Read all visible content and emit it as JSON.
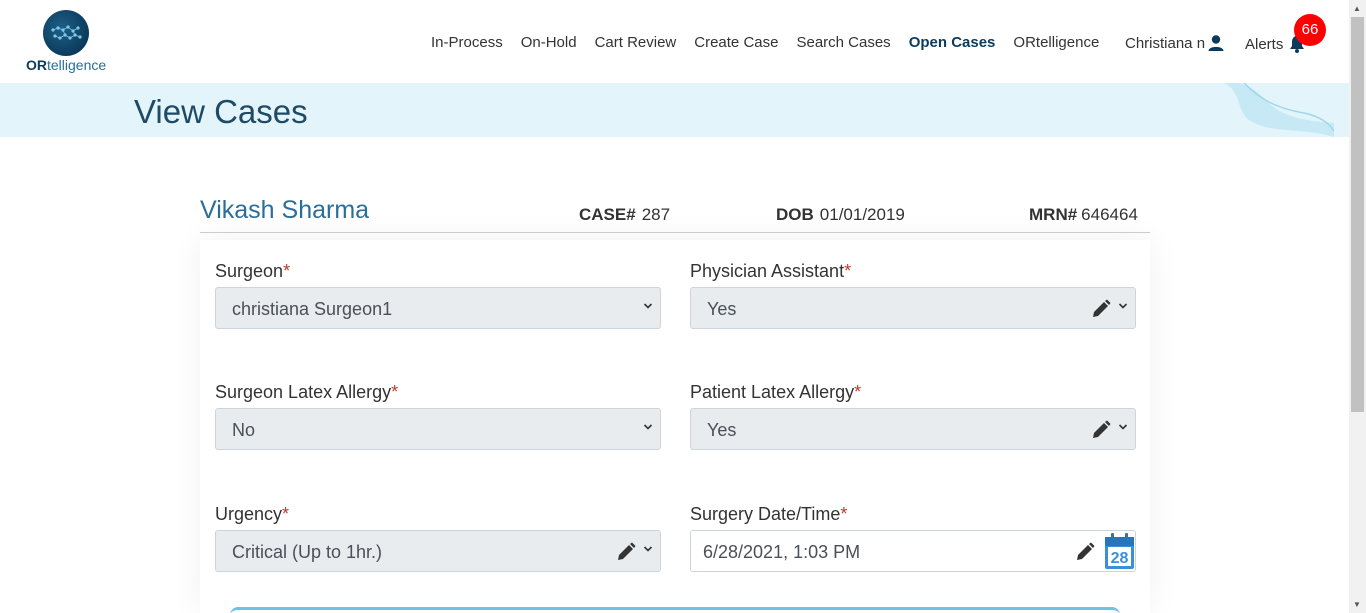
{
  "logo": {
    "wordmark_bold": "OR",
    "wordmark_rest": "telligence"
  },
  "nav": {
    "links": [
      {
        "label": "In-Process",
        "active": false
      },
      {
        "label": "On-Hold",
        "active": false
      },
      {
        "label": "Cart Review",
        "active": false
      },
      {
        "label": "Create Case",
        "active": false
      },
      {
        "label": "Search Cases",
        "active": false
      },
      {
        "label": "Open Cases",
        "active": true
      },
      {
        "label": "ORtelligence",
        "active": false
      }
    ],
    "user_label": "Christiana n",
    "alerts_label": "Alerts",
    "alerts_count": "66"
  },
  "page": {
    "title": "View Cases"
  },
  "patient": {
    "name": "Vikash Sharma",
    "case_label": "CASE#",
    "case_value": "287",
    "dob_label": "DOB",
    "dob_value": "01/01/2019",
    "mrn_label": "MRN#",
    "mrn_value": "646464"
  },
  "form": {
    "required_mark": "*",
    "surgeon": {
      "label": "Surgeon",
      "value": "christiana Surgeon1"
    },
    "physician_assistant": {
      "label": "Physician Assistant",
      "value": "Yes"
    },
    "surgeon_latex_allergy": {
      "label": "Surgeon Latex Allergy",
      "value": "No"
    },
    "patient_latex_allergy": {
      "label": "Patient Latex Allergy",
      "value": "Yes"
    },
    "urgency": {
      "label": "Urgency",
      "value": "Critical (Up to 1hr.)"
    },
    "surgery_datetime": {
      "label": "Surgery Date/Time",
      "value": "6/28/2021, 1:03 PM",
      "calendar_day": "28"
    }
  },
  "colors": {
    "accent": "#0b3b5c",
    "title": "#1e4a66",
    "band": "#e3f5fb",
    "badge": "#ff0000",
    "required": "#c0392b",
    "calendar": "#3a8fd6"
  },
  "icons": [
    "user-icon",
    "bell-icon",
    "chevron-down-icon",
    "pencil-icon",
    "calendar-icon"
  ]
}
